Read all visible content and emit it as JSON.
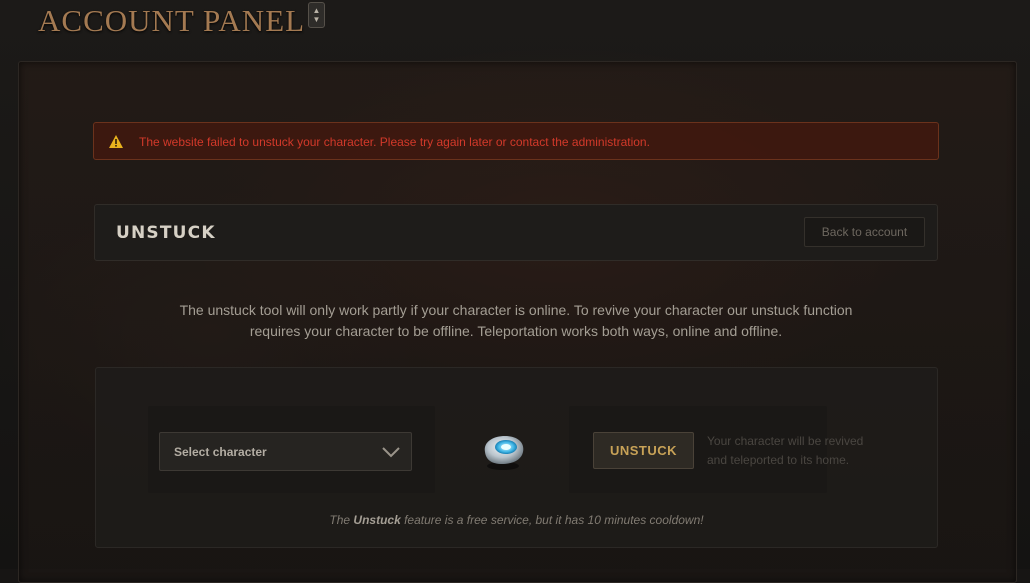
{
  "header": {
    "title": "ACCOUNT PANEL"
  },
  "alert": {
    "icon": "warning-icon",
    "message": "The website failed to unstuck your character. Please try again later or contact the administration.",
    "color": "#d2392a"
  },
  "section": {
    "title": "UNSTUCK",
    "back_button": "Back to account"
  },
  "info": {
    "line1": "The unstuck tool will only work partly if your character is online. To revive your character our unstuck function",
    "line2": "requires your character to be offline. Teleportation works both ways, online and offline."
  },
  "tool": {
    "select_placeholder": "Select character",
    "icon": "hearthstone-icon",
    "button_label": "UNSTUCK",
    "description": "Your character will be revived and teleported to its home."
  },
  "note": {
    "prefix": "The ",
    "emphasis": "Unstuck",
    "suffix": " feature is a free service, but it has 10 minutes cooldown!"
  },
  "colors": {
    "accent": "#c8a257",
    "title": "#a47a52",
    "error": "#d2392a"
  }
}
